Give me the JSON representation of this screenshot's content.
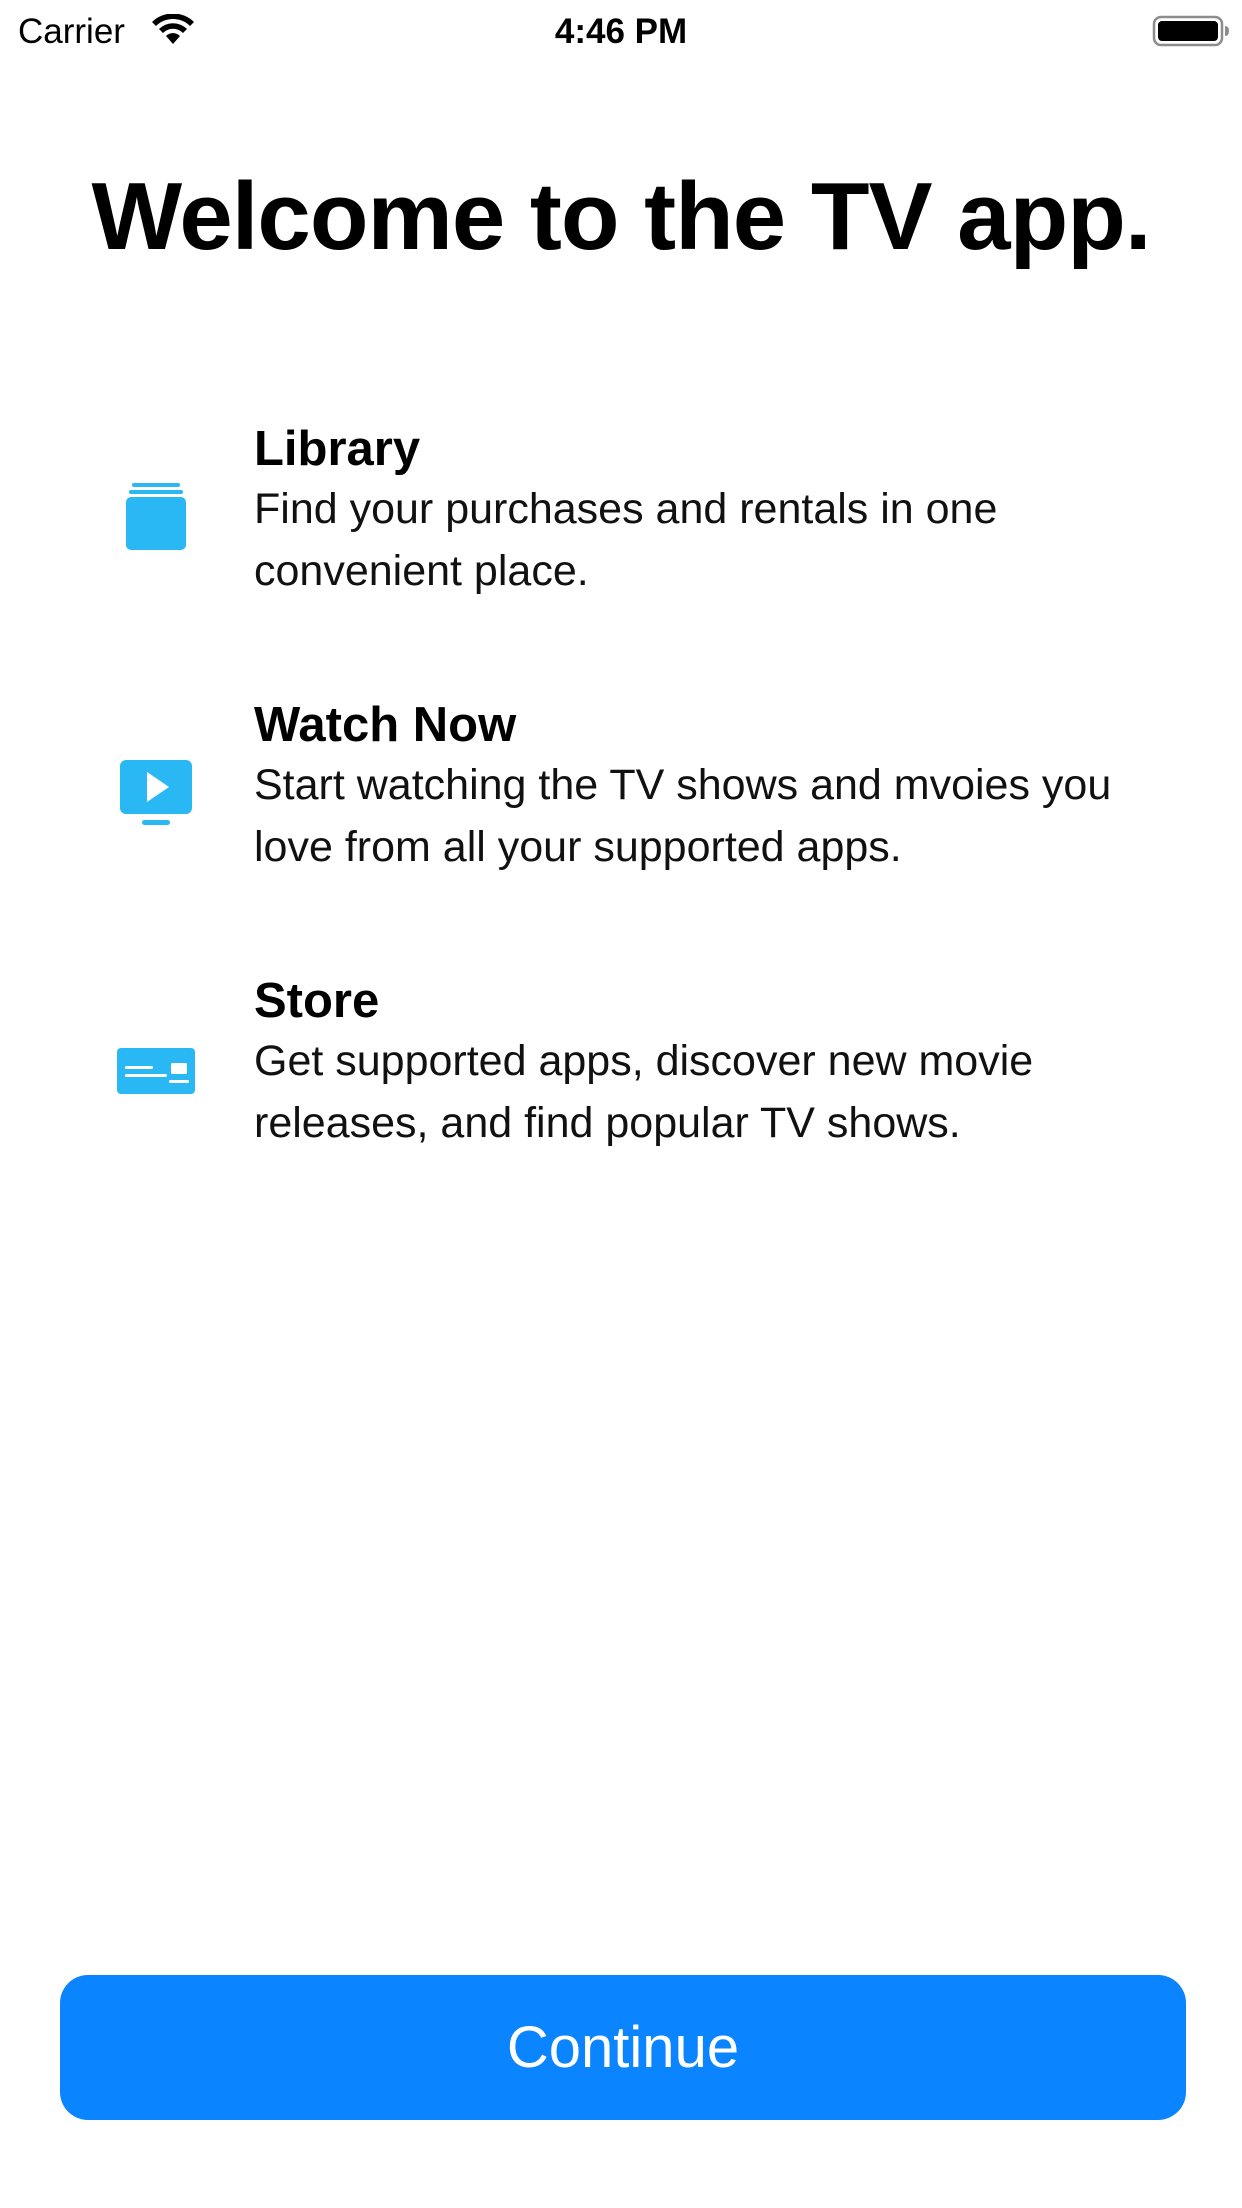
{
  "status_bar": {
    "carrier": "Carrier",
    "time": "4:46 PM",
    "wifi_icon": "wifi-icon",
    "battery_icon": "battery-icon"
  },
  "title": "Welcome to the TV app.",
  "features": [
    {
      "icon": "library-stack-icon",
      "heading": "Library",
      "description": "Find your purchases and rentals in one convenient place."
    },
    {
      "icon": "tv-play-icon",
      "heading": "Watch Now",
      "description": "Start watching the TV shows and mvoies you love from all your supported apps."
    },
    {
      "icon": "store-card-icon",
      "heading": "Store",
      "description": "Get supported apps, discover new movie releases, and find popular TV shows."
    }
  ],
  "continue_label": "Continue",
  "colors": {
    "accent": "#0a84ff",
    "icon_blue": "#2ab8f5",
    "background": "#ffffff",
    "text": "#000000"
  }
}
